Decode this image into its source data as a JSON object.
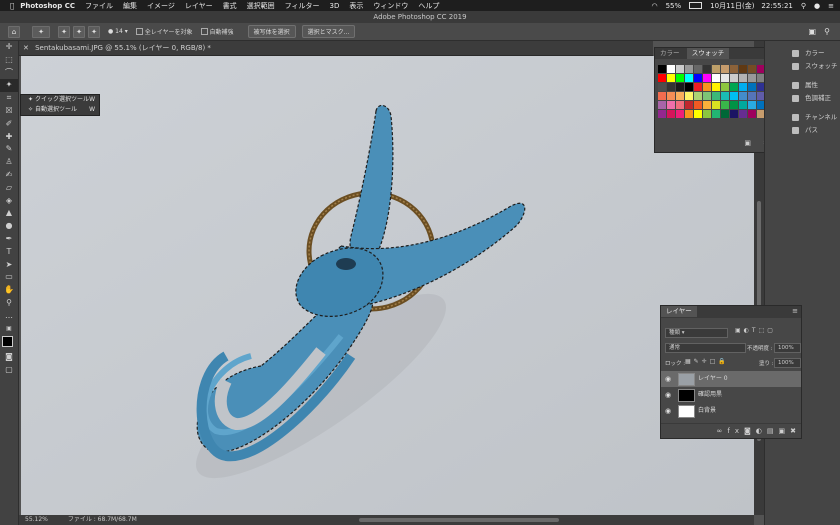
{
  "menubar": {
    "app": "Photoshop CC",
    "items": [
      "ファイル",
      "編集",
      "イメージ",
      "レイヤー",
      "書式",
      "選択範囲",
      "フィルター",
      "3D",
      "表示",
      "ウィンドウ",
      "ヘルプ"
    ],
    "battery": "55%",
    "datetime": "10月11日(金)　22:55:21"
  },
  "window_title": "Adobe Photoshop CC 2019",
  "options": {
    "size_value": "14",
    "sample_all_layers": "全レイヤーを対象",
    "auto_enhance": "自動補強",
    "select_subject": "被写体を選択",
    "select_and_mask": "選択とマスク..."
  },
  "document": {
    "tab": "Sentakubasami.JPG @ 55.1% (レイヤー 0, RGB/8) *",
    "zoom": "55.12%",
    "file_info": "ファイル : 68.7M/68.7M"
  },
  "flyout": {
    "items": [
      {
        "label": "クイック選択ツール",
        "key": "W"
      },
      {
        "label": "自動選択ツール",
        "key": "W"
      }
    ]
  },
  "swatches_panel": {
    "tabs": [
      "カラー",
      "スウォッチ"
    ],
    "active_tab": "スウォッチ",
    "colors": [
      "#000000",
      "#ffffff",
      "#cccccc",
      "#999999",
      "#666666",
      "#333333",
      "#bd9f69",
      "#c69c6d",
      "#8c6239",
      "#603913",
      "#754c24",
      "#9e005d",
      "#ed1c24",
      "#ff0000",
      "#ffff00",
      "#00ff00",
      "#00ffff",
      "#0000ff",
      "#ff00ff",
      "#ffffff",
      "#e6e6e6",
      "#cccccc",
      "#b3b3b3",
      "#999999",
      "#808080",
      "#666666",
      "#4d4d4d",
      "#333333",
      "#1a1a1a",
      "#000000",
      "#ed1c24",
      "#f7941d",
      "#fff200",
      "#8dc63f",
      "#00a651",
      "#00aeef",
      "#0072bc",
      "#2e3192",
      "#662d91",
      "#f26c4f",
      "#f68e56",
      "#fbaf5d",
      "#fff568",
      "#acd373",
      "#7cc576",
      "#3bb878",
      "#1abbb4",
      "#00bff3",
      "#438ccb",
      "#5574b9",
      "#605ca8",
      "#855fa8",
      "#a864a8",
      "#f06eaa",
      "#f26d7d",
      "#c1272d",
      "#f15a24",
      "#fbb03b",
      "#d9e021",
      "#39b54a",
      "#009245",
      "#00a99d",
      "#29abe2",
      "#0071bc",
      "#2e3192",
      "#93278f",
      "#d4145a",
      "#ed1e79",
      "#f7931e",
      "#ffff00",
      "#8cc63f",
      "#22b573",
      "#006837",
      "#1b1464",
      "#662d91",
      "#9e005d",
      "#c69c6d",
      "#736357"
    ]
  },
  "dock": {
    "items": [
      {
        "label": "カラー",
        "icon": "color-icon"
      },
      {
        "label": "スウォッチ",
        "icon": "swatches-icon"
      },
      {
        "label": "属性",
        "icon": "properties-icon"
      },
      {
        "label": "色調補正",
        "icon": "adjustments-icon"
      },
      {
        "label": "チャンネル",
        "icon": "channels-icon"
      },
      {
        "label": "パス",
        "icon": "paths-icon"
      }
    ]
  },
  "layers_panel": {
    "title": "レイヤー",
    "filter": "種類",
    "blend_mode": "通常",
    "opacity_label": "不透明度 :",
    "opacity": "100%",
    "lock_label": "ロック :",
    "fill_label": "塗り :",
    "fill": "100%",
    "layers": [
      {
        "name": "レイヤー 0",
        "selected": true
      },
      {
        "name": "確認用黒",
        "selected": false
      },
      {
        "name": "白背景",
        "selected": false
      }
    ]
  }
}
